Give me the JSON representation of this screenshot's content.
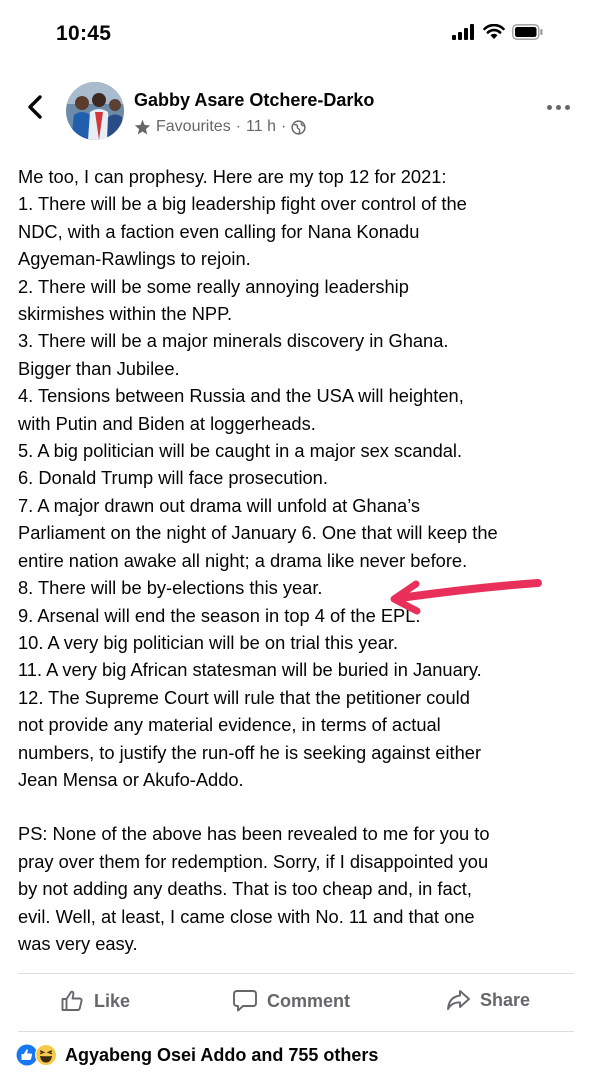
{
  "status_bar": {
    "time": "10:45"
  },
  "post": {
    "author": "Gabby Asare Otchere-Darko",
    "audience": "Favourites",
    "separator": "·",
    "time_ago": "11 h",
    "lines": [
      "Me too, I can prophesy. Here are my top 12 for 2021:",
      "1. There will be a big leadership fight over control of the",
      "NDC, with a faction even calling for Nana Konadu",
      "Agyeman-Rawlings to rejoin.",
      "2. There will be some really annoying leadership",
      "skirmishes within the NPP.",
      "3. There will be a major minerals discovery in Ghana.",
      "Bigger than Jubilee.",
      "4. Tensions between Russia and the USA will heighten,",
      "with Putin and Biden at loggerheads.",
      "5. A big politician will be caught in a major sex scandal.",
      "6. Donald Trump will face prosecution.",
      "7. A major drawn out drama will unfold at Ghana’s",
      "Parliament on the night of January 6. One that will keep the",
      "entire nation awake all night; a drama like never before.",
      "8. There will be by-elections this year.",
      "9. Arsenal will end the season in top 4 of the EPL.",
      "10. A very big politician will be on trial this year.",
      "11.  A very big African statesman will be buried in January.",
      "12. The Supreme Court will rule that the petitioner could",
      "not provide any material evidence, in terms of actual",
      "numbers, to justify the run-off he is seeking against either",
      "Jean Mensa or Akufo-Addo.",
      "",
      "PS: None of the above has been revealed to me for you to",
      "pray over them for redemption. Sorry, if I disappointed you",
      "by not adding any deaths. That is too cheap and, in fact,",
      "evil. Well, at least, I came close with No. 11 and that one",
      "was very easy."
    ]
  },
  "actions": {
    "like": "Like",
    "comment": "Comment",
    "share": "Share"
  },
  "reactions": {
    "summary": "Agyabeng Osei Addo and 755 others"
  },
  "colors": {
    "annotation_arrow": "#e8305a",
    "like_blue": "#1877f2",
    "haha_yellow": "#f7c94b",
    "muted_gray": "#65676b"
  }
}
